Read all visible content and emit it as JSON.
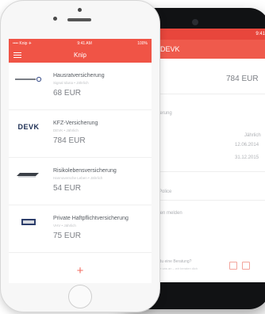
{
  "front": {
    "status_left": "•••• Knip ✈",
    "status_time": "9:41 AM",
    "status_right": "100%",
    "title": "Knip",
    "items": [
      {
        "logo": "",
        "title": "Hausratversicherung",
        "sub": "Signal Iduna • Jährlich",
        "price": "68 EUR"
      },
      {
        "logo": "DEVK",
        "title": "KFZ-Versicherung",
        "sub": "DEVK • Jährlich",
        "price": "784 EUR"
      },
      {
        "logo": "",
        "title": "Risikolebensversicherung",
        "sub": "Hannoversche Leben • Jährlich",
        "price": "54 EUR"
      },
      {
        "logo": "",
        "title": "Private Haftpflichtversicherung",
        "sub": "VHV • Jährlich",
        "price": "75 EUR"
      }
    ],
    "add_label": "+"
  },
  "back": {
    "status": "9:41",
    "title": "DEVK",
    "price": "784 EUR",
    "section": "cherung",
    "row1_value": "Jährlich",
    "row2_value": "12.06.2014",
    "row3_value": "31.12.2015",
    "police": "e Police",
    "report": "aden melden",
    "advice": "chst du eine Beratung?",
    "advice_sub": "iten Sie uns an – wir beraten dich"
  },
  "colors": {
    "accent": "#f05446",
    "text_dark": "#555a60",
    "text_muted": "#c1c3c6"
  }
}
